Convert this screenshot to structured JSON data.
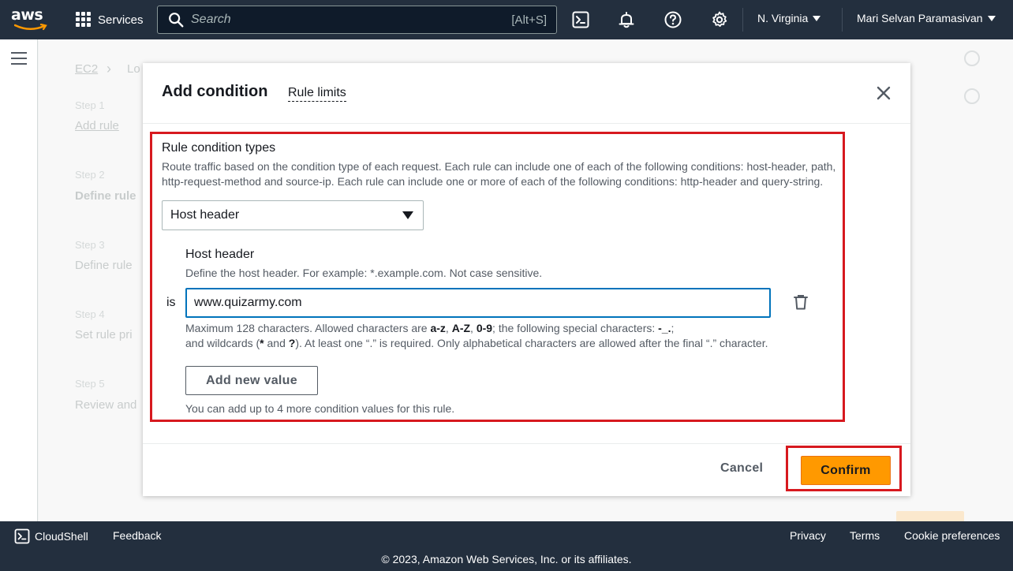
{
  "topnav": {
    "logo": "aws",
    "services_label": "Services",
    "search_placeholder": "Search",
    "search_shortcut": "[Alt+S]",
    "icons": [
      "cloudshell-icon",
      "bell-icon",
      "help-icon",
      "settings-icon"
    ],
    "region": "N. Virginia",
    "user": "Mari Selvan Paramasivan"
  },
  "modal": {
    "title": "Add condition",
    "title_link": "Rule limits",
    "rule_condition": {
      "label": "Rule condition types",
      "description_line1": "Route traffic based on the condition type of each request. Each rule can include one of each of the following conditions: host-header, path,",
      "description_line2": "http-request-method and source-ip. Each rule can include one or more of each of the following conditions: http-header and query-string.",
      "selected": "Host header"
    },
    "host_header": {
      "label": "Host header",
      "description": "Define the host header. For example: *.example.com. Not case sensitive.",
      "operator": "is",
      "value": "www.quizarmy.com",
      "constraint_pre": "Maximum 128 characters. Allowed characters are ",
      "chars_lower": "a-z",
      "sep1": ", ",
      "chars_upper": "A-Z",
      "sep2": ", ",
      "chars_digits": "0-9",
      "constraint_mid": "; the following special characters: ",
      "chars_special": "-_.",
      "constraint_end": ";",
      "line2_pre": "and wildcards (",
      "wild_star": "*",
      "line2_and": " and ",
      "wild_q": "?",
      "line2_post": "). At least one “.” is required. Only alphabetical characters are allowed after the final “.” character.",
      "add_value_button": "Add new value",
      "limit_note": "You can add up to 4 more condition values for this rule."
    },
    "footer": {
      "cancel": "Cancel",
      "confirm": "Confirm"
    }
  },
  "background": {
    "breadcrumb_root": "EC2",
    "breadcrumb_next": "Lo",
    "steps": [
      {
        "step": "Step 1",
        "title": "Add rule"
      },
      {
        "step": "Step 2",
        "title": "Define rule"
      },
      {
        "step": "Step 3",
        "title": "Define rule"
      },
      {
        "step": "Step 4",
        "title": "Set rule pri"
      },
      {
        "step": "Step 5",
        "title": "Review and"
      }
    ]
  },
  "footer": {
    "cloudshell": "CloudShell",
    "feedback": "Feedback",
    "privacy": "Privacy",
    "terms": "Terms",
    "cookies": "Cookie preferences",
    "copyright": "© 2023, Amazon Web Services, Inc. or its affiliates."
  },
  "colors": {
    "nav_bg": "#232f3e",
    "accent_orange": "#ff9900",
    "focus_blue": "#0073bb",
    "annotation_red": "#d7191f"
  }
}
